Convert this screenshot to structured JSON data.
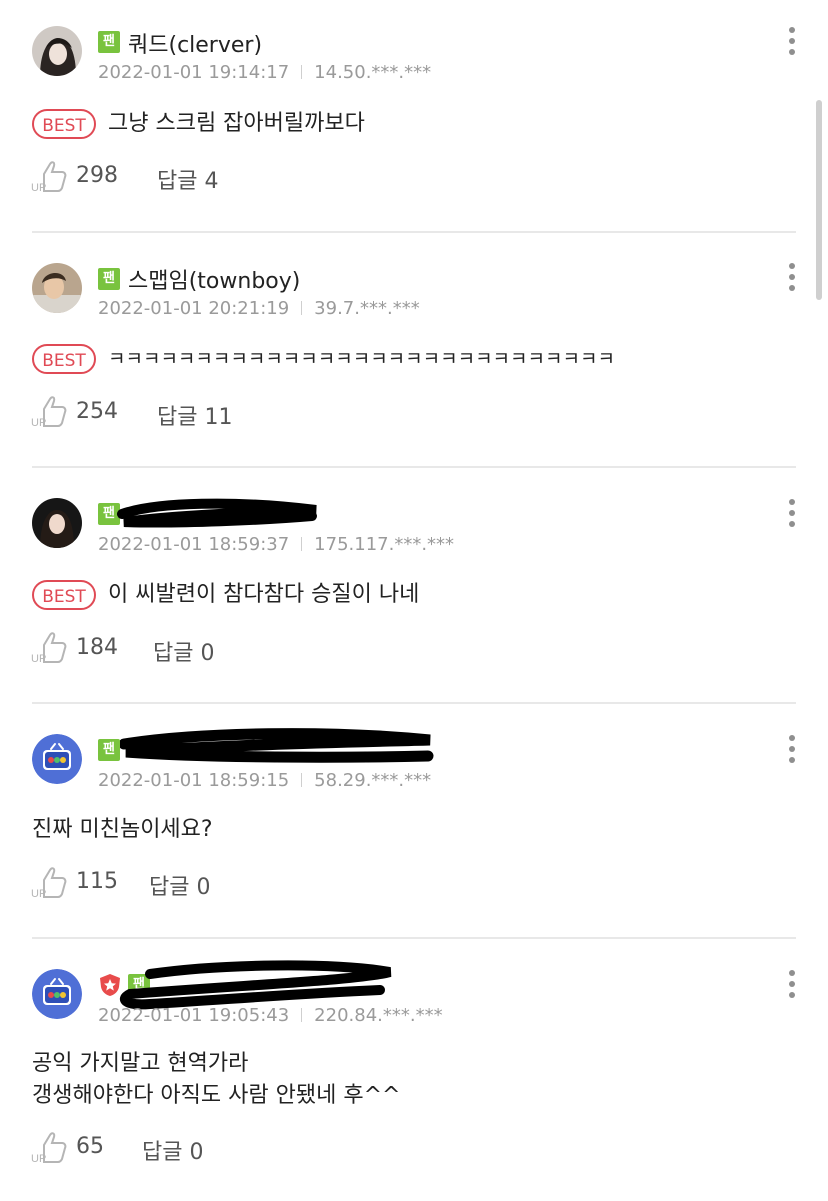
{
  "comments": [
    {
      "nickname": "쿼드(clerver)",
      "badge": "팬",
      "datetime": "2022-01-01 19:14:17",
      "ip": "14.50.***.***",
      "best": true,
      "best_label": "BEST",
      "lines": [
        "그냥 스크림 잡아버릴까보다"
      ],
      "up_count": "298",
      "reply_label": "답글 4"
    },
    {
      "nickname": "스맵임(townboy)",
      "badge": "팬",
      "datetime": "2022-01-01 20:21:19",
      "ip": "39.7.***.***",
      "best": true,
      "best_label": "BEST",
      "lines": [
        "ㅋㅋㅋㅋㅋㅋㅋㅋㅋㅋㅋㅋㅋㅋㅋㅋㅋㅋㅋㅋㅋㅋㅋㅋㅋㅋㅋㅋㅋ"
      ],
      "up_count": "254",
      "reply_label": "답글 11"
    },
    {
      "nickname": "",
      "badge": "팬",
      "datetime": "2022-01-01 18:59:37",
      "ip": "175.117.***.***",
      "best": true,
      "best_label": "BEST",
      "lines": [
        "이 씨발련이 참다참다 승질이 나네"
      ],
      "up_count": "184",
      "reply_label": "답글 0"
    },
    {
      "nickname": "",
      "badge": "팬",
      "datetime": "2022-01-01 18:59:15",
      "ip": "58.29.***.***",
      "best": false,
      "lines": [
        "진짜 미친놈이세요?"
      ],
      "up_count": "115",
      "reply_label": "답글 0"
    },
    {
      "nickname": "",
      "badge": "팬",
      "datetime": "2022-01-01 19:05:43",
      "ip": "220.84.***.***",
      "best": false,
      "lines": [
        "공익 가지말고 현역가라",
        "갱생해야한다 아직도 사람 안됐네 후^^"
      ],
      "up_count": "65",
      "reply_label": "답글 0"
    }
  ],
  "icons": {
    "more": "more-vertical-icon",
    "up": "thumbs-up-icon"
  },
  "colors": {
    "best": "#e04a55",
    "fan_badge": "#79c33e",
    "meta_text": "#9a9a9a"
  }
}
